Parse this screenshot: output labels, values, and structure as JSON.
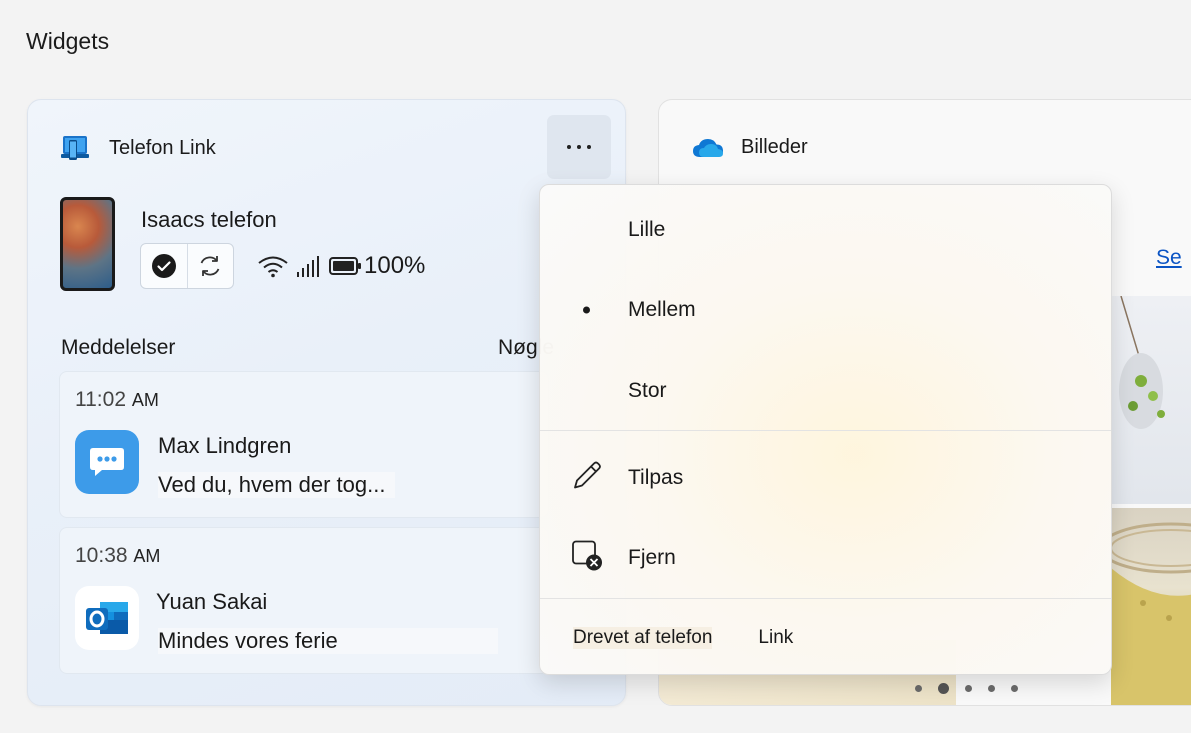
{
  "page": {
    "title": "Widgets"
  },
  "phone_widget": {
    "title_part1": "Telefon",
    "title_part2": "Link",
    "more_icon": "more-horizontal-icon",
    "device_name": "Isaacs telefon",
    "battery": "100%",
    "notifications_label": "Meddelelser",
    "key_label": "Nøgle",
    "notifications": [
      {
        "time": "11:02",
        "ampm": "AM",
        "sender": "Max Lindgren",
        "body": "Ved du, hvem der tog...",
        "app_icon": "messages-icon"
      },
      {
        "time": "10:38",
        "ampm": "AM",
        "sender": "Yuan Sakai",
        "body": "Mindes vores ferie",
        "app_icon": "outlook-icon"
      }
    ]
  },
  "photos_widget": {
    "title": "Billeder",
    "see_link": "Se"
  },
  "context_menu": {
    "sizes": [
      {
        "label": "Lille",
        "selected": false
      },
      {
        "label": "Mellem",
        "selected": true
      },
      {
        "label": "Stor",
        "selected": false
      }
    ],
    "customize_label": "Tilpas",
    "remove_label": "Fjern",
    "footer_text": "Drevet af telefon",
    "footer_link": "Link"
  },
  "colors": {
    "accent_blue": "#0b54c4",
    "messages_blue": "#3d9be9",
    "outlook_blue": "#0f6cbd"
  }
}
